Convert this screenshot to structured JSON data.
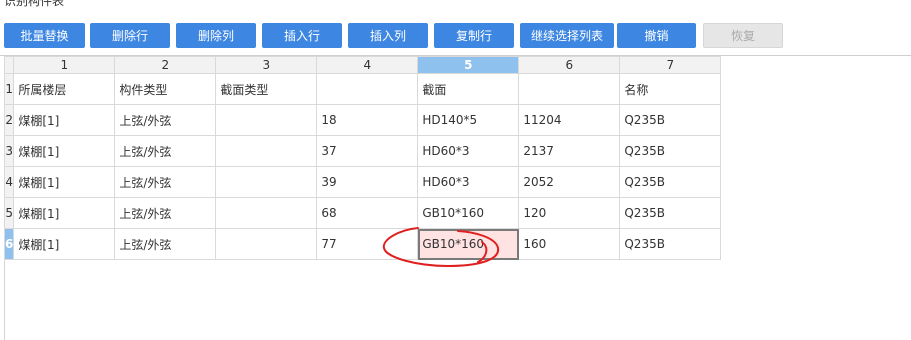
{
  "window": {
    "title": "识别构件表"
  },
  "toolbar": {
    "buttons": [
      {
        "label": "批量替换"
      },
      {
        "label": "删除行"
      },
      {
        "label": "删除列"
      },
      {
        "label": "插入行"
      },
      {
        "label": "插入列"
      },
      {
        "label": "复制行"
      },
      {
        "label": "继续选择列表"
      },
      {
        "label": "撤销"
      },
      {
        "label": "恢复",
        "disabled": true
      }
    ]
  },
  "grid": {
    "column_headers": [
      "1",
      "2",
      "3",
      "4",
      "5",
      "6",
      "7"
    ],
    "active_column": "5",
    "active_row": "6",
    "rows": [
      {
        "header": "1",
        "cells": [
          "所属楼层",
          "构件类型",
          "截面类型",
          "",
          "截面",
          "",
          "名称"
        ]
      },
      {
        "header": "2",
        "cells": [
          "煤棚[1]",
          "上弦/外弦",
          "",
          "18",
          "HD140*5",
          "11204",
          "Q235B"
        ]
      },
      {
        "header": "3",
        "cells": [
          "煤棚[1]",
          "上弦/外弦",
          "",
          "37",
          "HD60*3",
          "2137",
          "Q235B"
        ]
      },
      {
        "header": "4",
        "cells": [
          "煤棚[1]",
          "上弦/外弦",
          "",
          "39",
          "HD60*3",
          "2052",
          "Q235B"
        ]
      },
      {
        "header": "5",
        "cells": [
          "煤棚[1]",
          "上弦/外弦",
          "",
          "68",
          "GB10*160",
          "120",
          "Q235B"
        ]
      },
      {
        "header": "6",
        "cells": [
          "煤棚[1]",
          "上弦/外弦",
          "",
          "77",
          "GB10*160",
          "160",
          "Q235B"
        ]
      }
    ]
  },
  "colors": {
    "button": "#3d86e2",
    "header_active": "#8ec1ee",
    "selected_cell": "#ffe2e2",
    "annotation": "#e02020"
  }
}
